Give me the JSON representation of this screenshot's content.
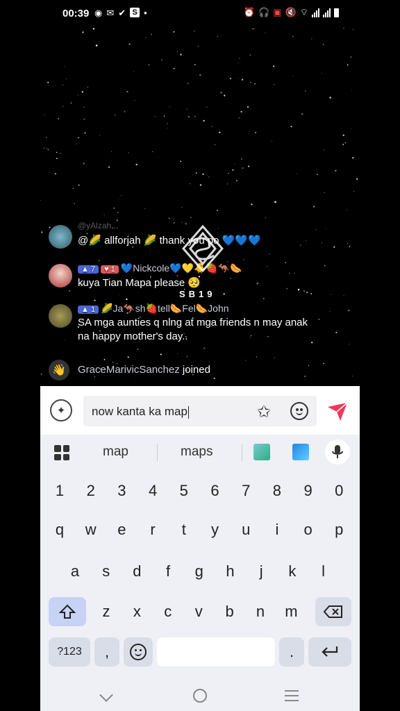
{
  "status": {
    "time": "00:39",
    "s_badge": "S",
    "icons": [
      "messenger-icon",
      "email-icon",
      "check-icon",
      "dot-icon",
      "alarm-icon",
      "headset-icon",
      "nfc-icon",
      "mute-icon",
      "data-icon",
      "wifi-icon",
      "signal-icon",
      "battery-icon"
    ]
  },
  "chat": {
    "faded_top": "@yAlzah...",
    "messages": [
      {
        "user": "",
        "text": "@🌽 allforjah 🌽 thank you po 💙💙💙"
      },
      {
        "badges": [
          "7",
          "1"
        ],
        "user": "💙Nickcole💙💛🐥🍓🦘🌭",
        "text": "kuya Tian Mapa please 🥺"
      },
      {
        "badges": [
          "1"
        ],
        "user": "🌽Ja🦘sh🍓tell🌭Fel🌭John",
        "text": "SA mga aunties q nlng at mga friends n may anak",
        "text2": "na happy mother's day.."
      }
    ],
    "joined_user": "GraceMarivicSanchez",
    "joined_text": " joined"
  },
  "logo_text": "SB19",
  "input": {
    "value": "now kanta ka map"
  },
  "keyboard": {
    "suggestions": [
      "map",
      "maps"
    ],
    "number_row": [
      "1",
      "2",
      "3",
      "4",
      "5",
      "6",
      "7",
      "8",
      "9",
      "0"
    ],
    "row1": [
      "q",
      "w",
      "e",
      "r",
      "t",
      "y",
      "u",
      "i",
      "o",
      "p"
    ],
    "row2": [
      "a",
      "s",
      "d",
      "f",
      "g",
      "h",
      "j",
      "k",
      "l"
    ],
    "row3": [
      "z",
      "x",
      "c",
      "v",
      "b",
      "n",
      "m"
    ],
    "symbols_key": "?123",
    "comma_key": ",",
    "period_key": "."
  },
  "colors": {
    "send": "#f0365a",
    "shift_bg": "#c7d3f5",
    "keyboard_bg": "#eef0f5",
    "badge_blue": "#4a67d8",
    "badge_red": "#e0575c"
  }
}
